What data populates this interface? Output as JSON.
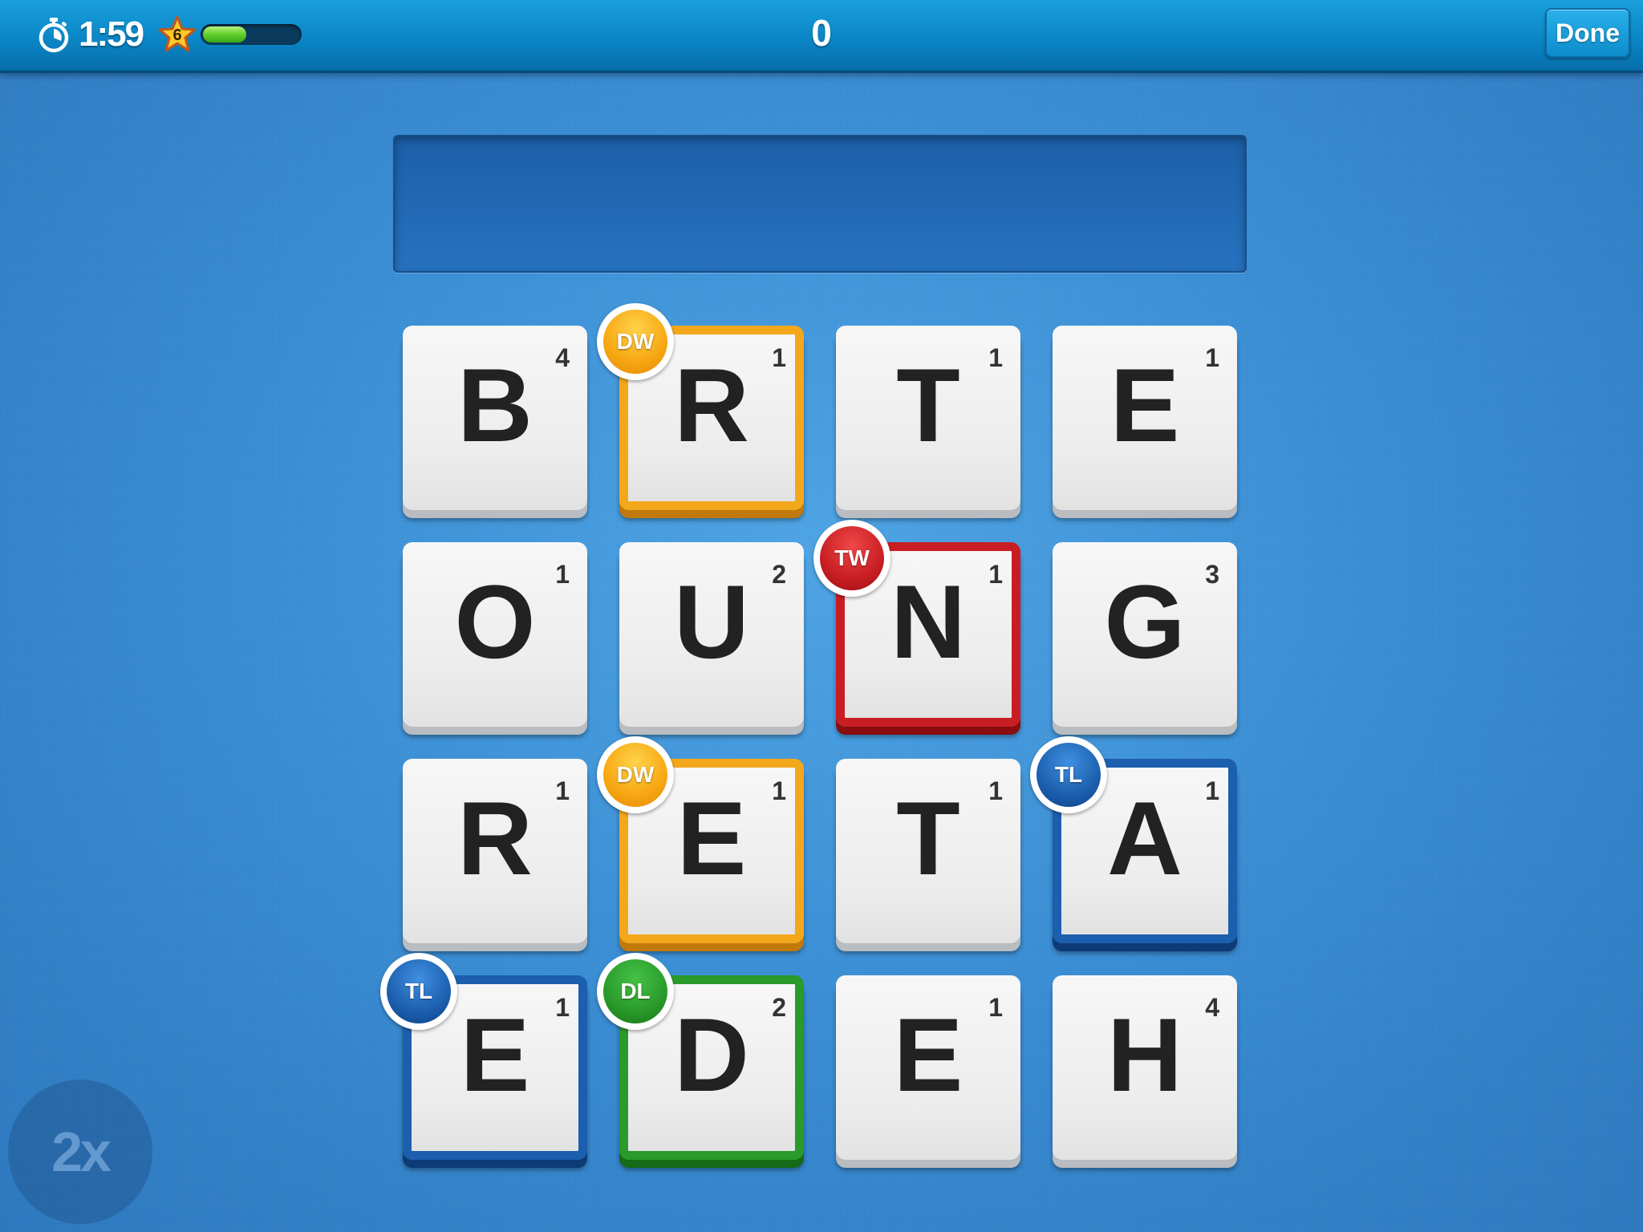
{
  "header": {
    "timer": "1:59",
    "level": "6",
    "xp_progress": 0.45,
    "score": "0",
    "done_label": "Done"
  },
  "word_box": {
    "current_word": ""
  },
  "multiplier": "2x",
  "colors": {
    "DW": "#f3a81c",
    "TW": "#c81e23",
    "TL": "#1c5fae",
    "DL": "#2a9a2a"
  },
  "board": {
    "rows": [
      [
        {
          "letter": "B",
          "points": "4",
          "bonus": ""
        },
        {
          "letter": "R",
          "points": "1",
          "bonus": "DW"
        },
        {
          "letter": "T",
          "points": "1",
          "bonus": ""
        },
        {
          "letter": "E",
          "points": "1",
          "bonus": ""
        }
      ],
      [
        {
          "letter": "O",
          "points": "1",
          "bonus": ""
        },
        {
          "letter": "U",
          "points": "2",
          "bonus": ""
        },
        {
          "letter": "N",
          "points": "1",
          "bonus": "TW"
        },
        {
          "letter": "G",
          "points": "3",
          "bonus": ""
        }
      ],
      [
        {
          "letter": "R",
          "points": "1",
          "bonus": ""
        },
        {
          "letter": "E",
          "points": "1",
          "bonus": "DW"
        },
        {
          "letter": "T",
          "points": "1",
          "bonus": ""
        },
        {
          "letter": "A",
          "points": "1",
          "bonus": "TL"
        }
      ],
      [
        {
          "letter": "E",
          "points": "1",
          "bonus": "TL"
        },
        {
          "letter": "D",
          "points": "2",
          "bonus": "DL"
        },
        {
          "letter": "E",
          "points": "1",
          "bonus": ""
        },
        {
          "letter": "H",
          "points": "4",
          "bonus": ""
        }
      ]
    ]
  }
}
